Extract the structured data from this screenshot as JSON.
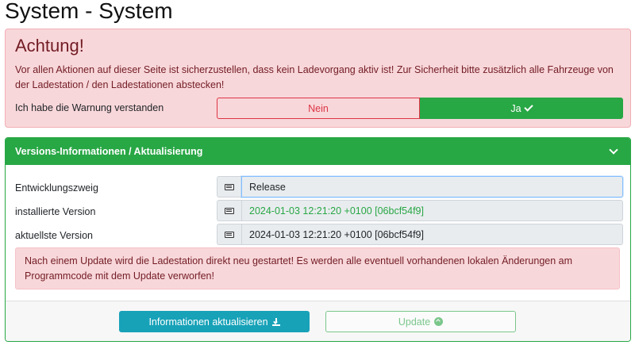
{
  "page": {
    "title": "System - System"
  },
  "warning": {
    "heading": "Achtung!",
    "text": "Vor allen Aktionen auf dieser Seite ist sicherzustellen, dass kein Ladevorgang aktiv ist! Zur Sicherheit bitte zusätzlich alle Fahrzeuge von der Ladestation / den Ladestationen abstecken!",
    "ack_label": "Ich habe die Warnung verstanden",
    "options": {
      "no": "Nein",
      "yes": "Ja"
    },
    "selected": "yes"
  },
  "versions": {
    "header": "Versions-Informationen / Aktualisierung",
    "rows": [
      {
        "label": "Entwicklungszweig",
        "value": "Release"
      },
      {
        "label": "installierte Version",
        "value": "2024-01-03 12:21:20 +0100 [06bcf54f9]"
      },
      {
        "label": "aktuellste Version",
        "value": "2024-01-03 12:21:20 +0100 [06bcf54f9]"
      }
    ],
    "notice": "Nach einem Update wird die Ladestation direkt neu gestartet! Es werden alle eventuell vorhandenen lokalen Änderungen am Programmcode mit dem Update verworfen!",
    "buttons": {
      "refresh": "Informationen aktualisieren",
      "update": "Update"
    }
  },
  "colors": {
    "success": "#28a745",
    "danger": "#dc3545",
    "info": "#17a2b8",
    "danger_bg": "#f8d7da"
  }
}
